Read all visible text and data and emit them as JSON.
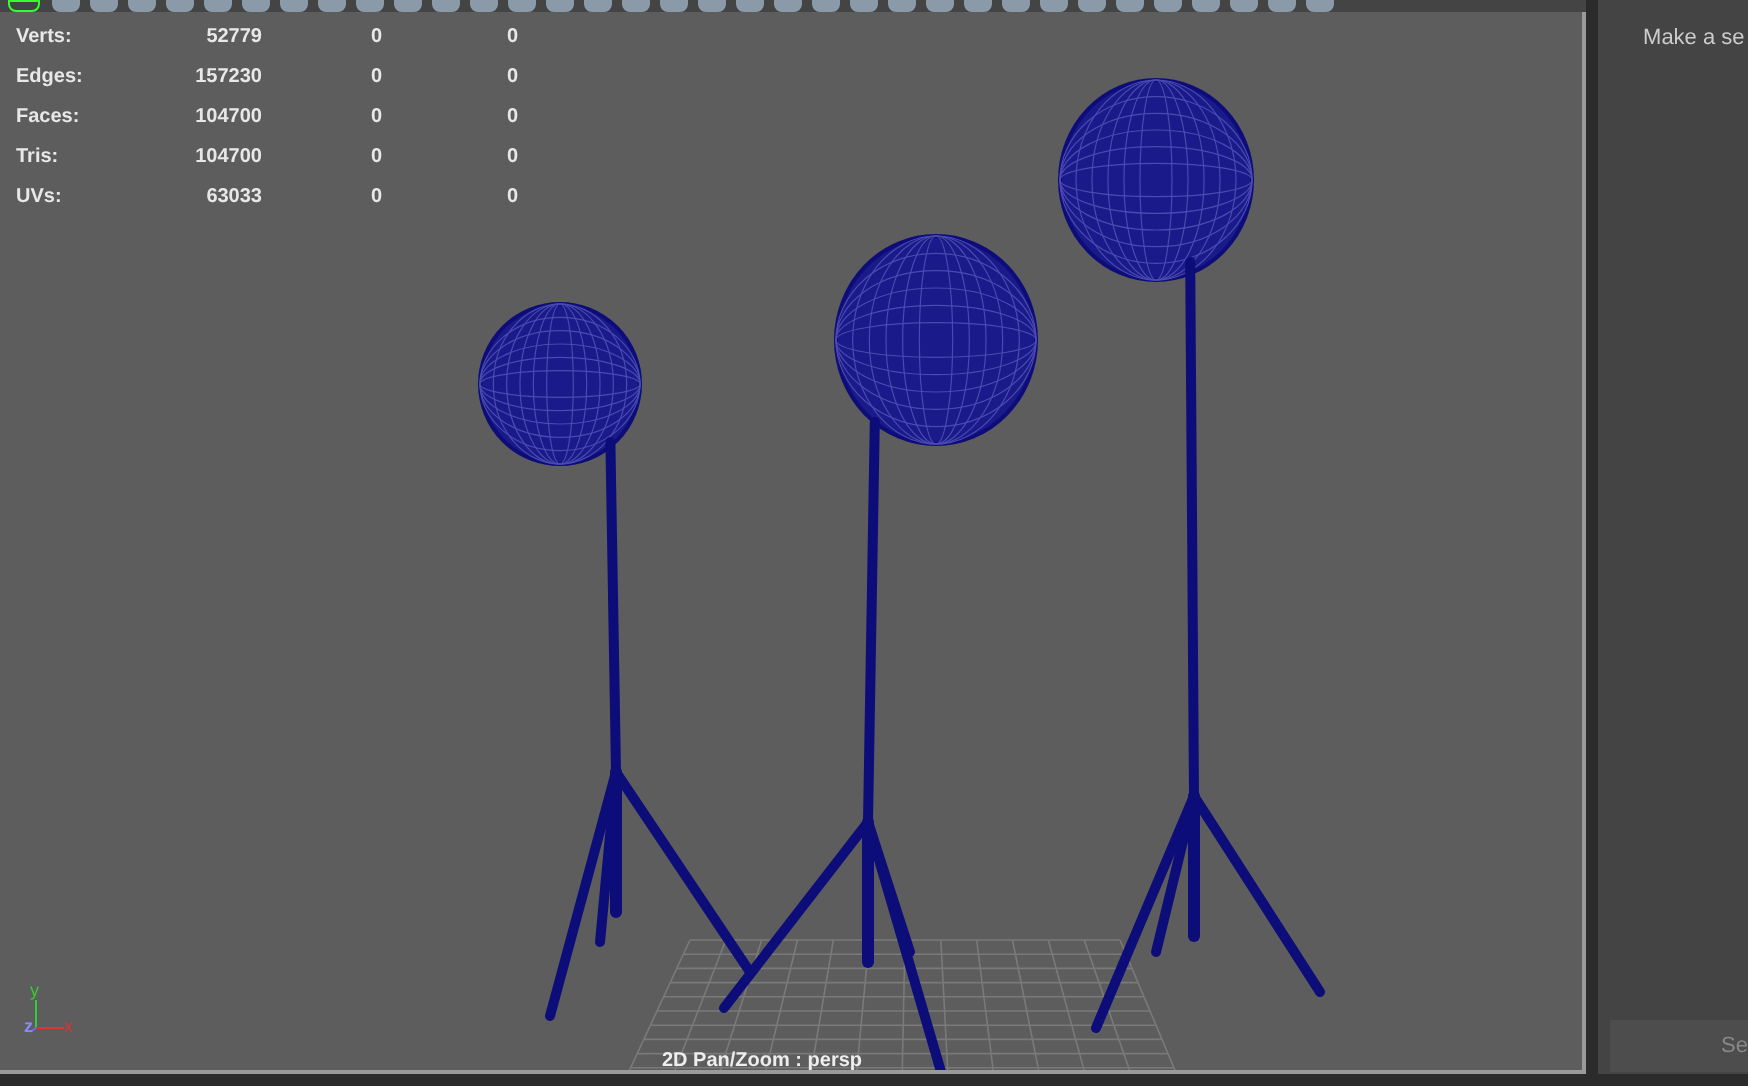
{
  "stats": [
    {
      "label": "Verts:",
      "values": [
        "52779",
        "0",
        "0"
      ]
    },
    {
      "label": "Edges:",
      "values": [
        "157230",
        "0",
        "0"
      ]
    },
    {
      "label": "Faces:",
      "values": [
        "104700",
        "0",
        "0"
      ]
    },
    {
      "label": "Tris:",
      "values": [
        "104700",
        "0",
        "0"
      ]
    },
    {
      "label": "UVs:",
      "values": [
        "63033",
        "0",
        "0"
      ]
    }
  ],
  "axes": {
    "y": "y",
    "z": "z",
    "x": "x"
  },
  "camera_label": "2D Pan/Zoom : persp",
  "side_panel": {
    "message": "Make a se",
    "button": "Se"
  }
}
